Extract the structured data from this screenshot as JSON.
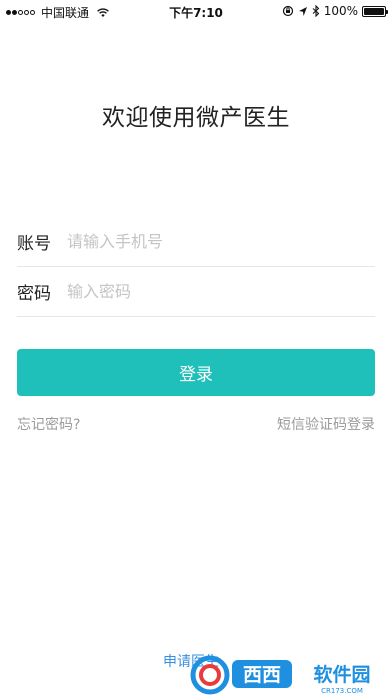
{
  "status_bar": {
    "signal_dots": 5,
    "signal_filled": 2,
    "carrier": "中国联通",
    "wifi_icon": "wifi-icon",
    "time": "下午7:10",
    "orientation_lock_icon": "orientation-lock-icon",
    "location_icon": "location-arrow-icon",
    "bluetooth_icon": "bluetooth-icon",
    "battery": "100%",
    "battery_level": 1.0
  },
  "title": "欢迎使用微产医生",
  "form": {
    "account": {
      "label": "账号",
      "placeholder": "请输入手机号",
      "value": ""
    },
    "password": {
      "label": "密码",
      "placeholder": "输入密码",
      "value": ""
    }
  },
  "login_button": "登录",
  "links": {
    "forgot_password": "忘记密码?",
    "sms_login": "短信验证码登录",
    "apply": "申请医生"
  },
  "watermark": {
    "text": "西西软件园",
    "subtext": "CR173.COM",
    "colors": {
      "logo_blue": "#1f8fe0",
      "logo_red": "#e93b3b"
    }
  },
  "colors": {
    "accent": "#1ec0b9",
    "link_blue": "#3a8fe0",
    "secondary_text": "#9a9a9a",
    "placeholder": "#c4c4c4"
  }
}
